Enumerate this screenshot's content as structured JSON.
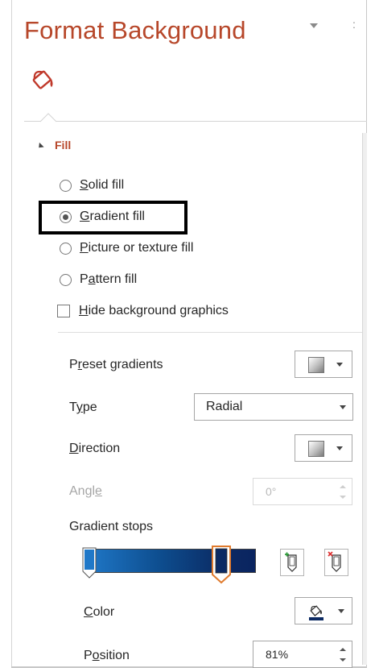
{
  "pane": {
    "title": "Format Background",
    "menu_icon": "chevron-down-icon",
    "close_glyph": ":",
    "tab_icon": "paint-bucket-icon"
  },
  "fill_section": {
    "header": "Fill",
    "expanded": true,
    "options": {
      "solid": {
        "label": "Solid fill",
        "mnemonic": "S",
        "selected": false
      },
      "gradient": {
        "label": "Gradient fill",
        "mnemonic": "G",
        "selected": true
      },
      "picture": {
        "label": "Picture or texture fill",
        "mnemonic": "P",
        "selected": false
      },
      "pattern": {
        "label": "Pattern fill",
        "mnemonic": "a",
        "selected": false
      }
    },
    "hide_background_graphics": {
      "label": "Hide background graphics",
      "mnemonic": "H",
      "checked": false
    }
  },
  "gradient": {
    "preset_label": "Preset gradients",
    "preset_icon": "gradient-swatch-icon",
    "type_label": "Type",
    "type_value": "Radial",
    "direction_label": "Direction",
    "direction_icon": "gradient-swatch-icon",
    "angle_label": "Angle",
    "angle_value": "0°",
    "angle_enabled": false,
    "stops_label": "Gradient stops",
    "stops": [
      {
        "position": 0,
        "color": "#1f78c8",
        "selected": false
      },
      {
        "position": 81,
        "color": "#0c2a63",
        "selected": true
      }
    ],
    "add_stop_icon": "add-gradient-stop-icon",
    "remove_stop_icon": "remove-gradient-stop-icon",
    "color_label": "Color",
    "color_icon": "fill-color-icon",
    "color_value": "#0c2a63",
    "position_label": "Position",
    "position_value": "81%"
  },
  "colors": {
    "accent": "#b7472a",
    "highlight_box": "#000000",
    "selected_stop_outline": "#e07b2e"
  }
}
